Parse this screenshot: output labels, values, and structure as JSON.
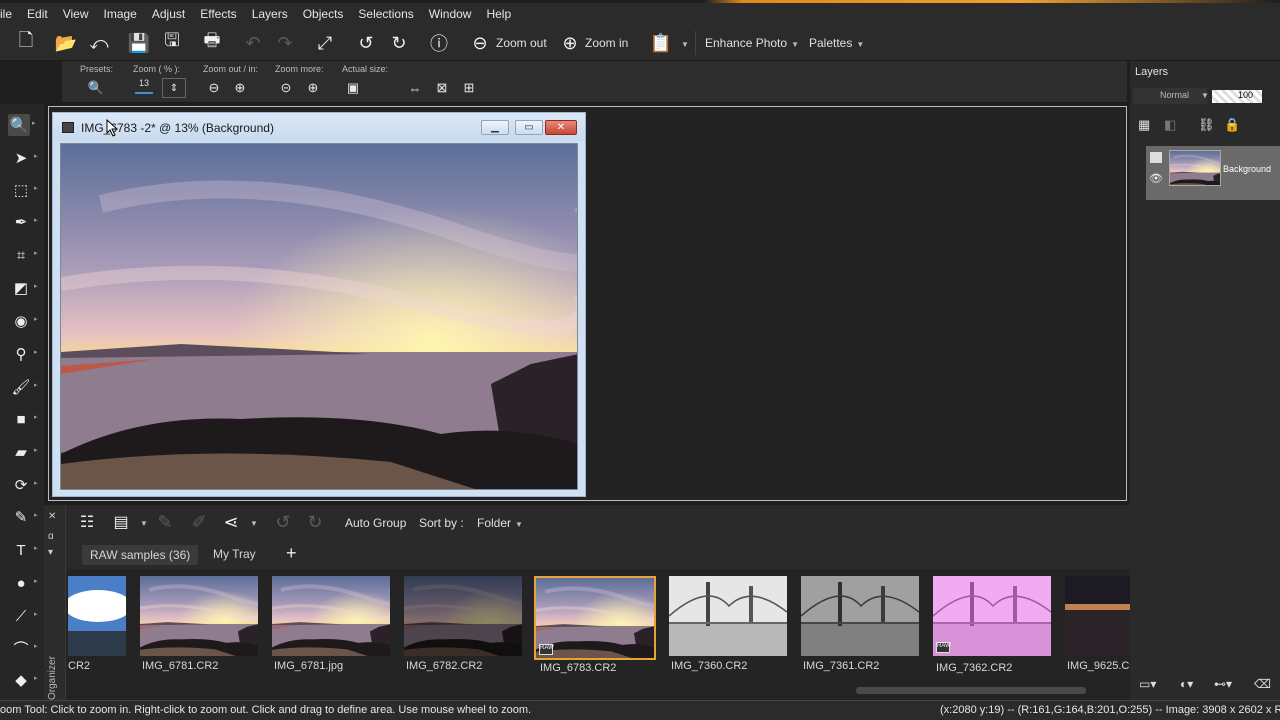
{
  "menu": [
    "ile",
    "Edit",
    "View",
    "Image",
    "Adjust",
    "Effects",
    "Layers",
    "Objects",
    "Selections",
    "Window",
    "Help"
  ],
  "toolbar": {
    "zoom_out": "Zoom out",
    "zoom_in": "Zoom in",
    "enhance_photo": "Enhance Photo",
    "palettes": "Palettes"
  },
  "tool_options": {
    "presets_label": "Presets:",
    "zoom_label": "Zoom ( % ):",
    "zoom_value": "13",
    "zoom_out_in_label": "Zoom out / in:",
    "zoom_more_label": "Zoom more:",
    "actual_size_label": "Actual size:"
  },
  "document": {
    "title": "IMG_6783 -2* @ 13% (Background)"
  },
  "organizer": {
    "auto_group": "Auto Group",
    "sort_by_label": "Sort by :",
    "sort_by_value": "Folder",
    "tabs": [
      "RAW samples (36)",
      "My Tray"
    ],
    "add_tab": "+",
    "side_label": "Organizer",
    "thumbnails": [
      {
        "caption": "CR2",
        "selected": false
      },
      {
        "caption": "IMG_6781.CR2",
        "selected": false
      },
      {
        "caption": "IMG_6781.jpg",
        "selected": false
      },
      {
        "caption": "IMG_6782.CR2",
        "selected": false
      },
      {
        "caption": "IMG_6783.CR2",
        "selected": true
      },
      {
        "caption": "IMG_7360.CR2",
        "selected": false
      },
      {
        "caption": "IMG_7361.CR2",
        "selected": false
      },
      {
        "caption": "IMG_7362.CR2",
        "selected": false
      },
      {
        "caption": "IMG_9625.C",
        "selected": false
      }
    ]
  },
  "layers": {
    "title": "Layers",
    "blend_mode": "Normal",
    "opacity": "100",
    "layer_name": "Background"
  },
  "status": {
    "left": "oom Tool: Click to zoom in. Right-click to zoom out. Click and drag to define area. Use mouse wheel to zoom.",
    "right": "(x:2080 y:19) -- (R:161,G:164,B:201,O:255) -- Image: 3908 x 2602 x R"
  },
  "colors": {
    "accent": "#e8a338",
    "panel": "#2b2b2b",
    "workspace": "#232323",
    "window_title": "#cfe0f2"
  }
}
